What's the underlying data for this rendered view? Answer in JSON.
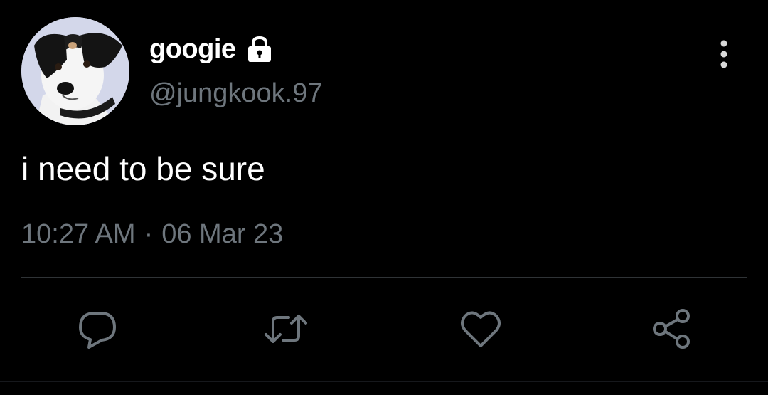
{
  "tweet": {
    "display_name": "googie",
    "handle": "@jungkook.97",
    "text": "i need to be sure",
    "time": "10:27 AM",
    "separator": "·",
    "date": "06 Mar 23"
  },
  "icons": {
    "account": "lock-icon",
    "menu": "more-vertical-icon",
    "actions": [
      "reply-icon",
      "retweet-icon",
      "like-icon",
      "share-icon"
    ]
  },
  "colors": {
    "background": "#000000",
    "primary_text": "#ffffff",
    "secondary_text": "#6e767d",
    "icon": "#6e767d",
    "divider": "#2f3336"
  }
}
